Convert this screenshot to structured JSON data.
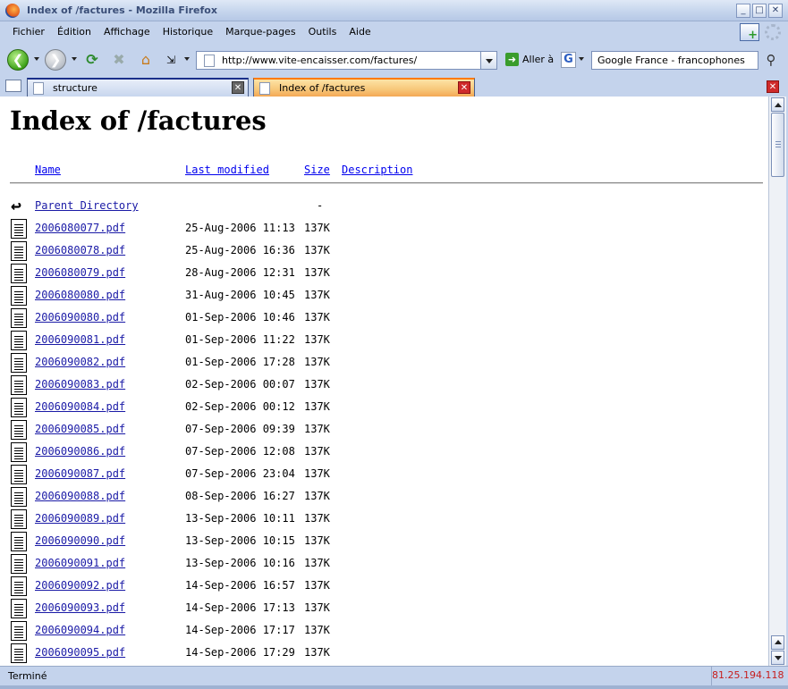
{
  "window": {
    "title": "Index of /factures - Mozilla Firefox",
    "minimize_glyph": "_",
    "maximize_glyph": "□",
    "close_glyph": "✕"
  },
  "menu": [
    "Fichier",
    "Édition",
    "Affichage",
    "Historique",
    "Marque-pages",
    "Outils",
    "Aide"
  ],
  "toolbar": {
    "back_glyph": "❮",
    "forward_glyph": "❯",
    "reload_glyph": "⟳",
    "stop_glyph": "✖",
    "home_glyph": "⌂",
    "url": "http://www.vite-encaisser.com/factures/",
    "go_glyph": "➜",
    "go_label": "Aller à",
    "engine_glyph": "G",
    "search_value": "Google France - francophones",
    "search_glyph": "⚲"
  },
  "tabs": [
    {
      "label": "structure",
      "active": false
    },
    {
      "label": "Index of /factures",
      "active": true
    }
  ],
  "tab_close_glyph": "✕",
  "page": {
    "heading": "Index of /factures",
    "columns": {
      "name": "Name",
      "modified": "Last modified",
      "size": "Size",
      "description": "Description"
    },
    "parent": {
      "name": "Parent Directory",
      "size": "-"
    },
    "files": [
      {
        "name": "2006080077.pdf",
        "modified": "25-Aug-2006 11:13",
        "size": "137K"
      },
      {
        "name": "2006080078.pdf",
        "modified": "25-Aug-2006 16:36",
        "size": "137K"
      },
      {
        "name": "2006080079.pdf",
        "modified": "28-Aug-2006 12:31",
        "size": "137K"
      },
      {
        "name": "2006080080.pdf",
        "modified": "31-Aug-2006 10:45",
        "size": "137K"
      },
      {
        "name": "2006090080.pdf",
        "modified": "01-Sep-2006 10:46",
        "size": "137K"
      },
      {
        "name": "2006090081.pdf",
        "modified": "01-Sep-2006 11:22",
        "size": "137K"
      },
      {
        "name": "2006090082.pdf",
        "modified": "01-Sep-2006 17:28",
        "size": "137K"
      },
      {
        "name": "2006090083.pdf",
        "modified": "02-Sep-2006 00:07",
        "size": "137K"
      },
      {
        "name": "2006090084.pdf",
        "modified": "02-Sep-2006 00:12",
        "size": "137K"
      },
      {
        "name": "2006090085.pdf",
        "modified": "07-Sep-2006 09:39",
        "size": "137K"
      },
      {
        "name": "2006090086.pdf",
        "modified": "07-Sep-2006 12:08",
        "size": "137K"
      },
      {
        "name": "2006090087.pdf",
        "modified": "07-Sep-2006 23:04",
        "size": "137K"
      },
      {
        "name": "2006090088.pdf",
        "modified": "08-Sep-2006 16:27",
        "size": "137K"
      },
      {
        "name": "2006090089.pdf",
        "modified": "13-Sep-2006 10:11",
        "size": "137K"
      },
      {
        "name": "2006090090.pdf",
        "modified": "13-Sep-2006 10:15",
        "size": "137K"
      },
      {
        "name": "2006090091.pdf",
        "modified": "13-Sep-2006 10:16",
        "size": "137K"
      },
      {
        "name": "2006090092.pdf",
        "modified": "14-Sep-2006 16:57",
        "size": "137K"
      },
      {
        "name": "2006090093.pdf",
        "modified": "14-Sep-2006 17:13",
        "size": "137K"
      },
      {
        "name": "2006090094.pdf",
        "modified": "14-Sep-2006 17:17",
        "size": "137K"
      },
      {
        "name": "2006090095.pdf",
        "modified": "14-Sep-2006 17:29",
        "size": "137K"
      }
    ]
  },
  "status": {
    "message": "Terminé",
    "ip": "81.25.194.118"
  },
  "colors": {
    "chrome": "#c4d3ec",
    "link": "#1a1aa6",
    "active_tab": "#f7c779",
    "close_red": "#cf2a2a",
    "ip_text": "#c61d1d"
  }
}
